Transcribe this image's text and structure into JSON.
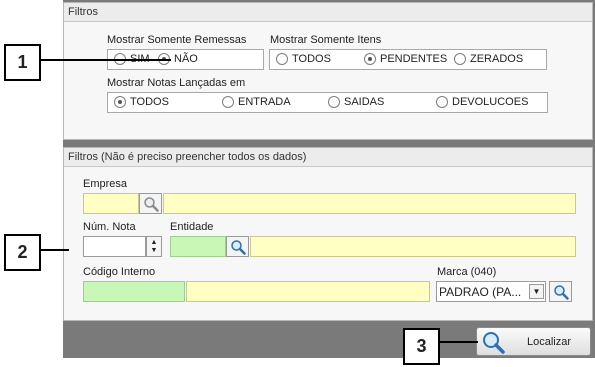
{
  "filters": {
    "title": "Filtros",
    "remessas": {
      "label": "Mostrar Somente Remessas",
      "options": [
        "SIM",
        "NÃO"
      ],
      "selected": "NÃO"
    },
    "itens": {
      "label": "Mostrar Somente Itens",
      "options": [
        "TODOS",
        "PENDENTES",
        "ZERADOS"
      ],
      "selected": "PENDENTES"
    },
    "notas": {
      "label": "Mostrar Notas Lançadas em",
      "options": [
        "TODOS",
        "ENTRADA",
        "SAIDAS",
        "DEVOLUCOES"
      ],
      "selected": "TODOS"
    }
  },
  "filters2": {
    "title": "Filtros (Não é preciso preencher todos os dados)",
    "empresa_label": "Empresa",
    "num_nota_label": "Núm. Nota",
    "entidade_label": "Entidade",
    "codigo_interno_label": "Código Interno",
    "marca_label": "Marca (040)",
    "marca_value": "PADRAO (PA..."
  },
  "localizar_label": "Localizar",
  "callouts": [
    "1",
    "2",
    "3"
  ],
  "colors": {
    "required_field": "#ffffc4",
    "key_field": "#c8f7b6",
    "footer": "#7a7a7a"
  }
}
